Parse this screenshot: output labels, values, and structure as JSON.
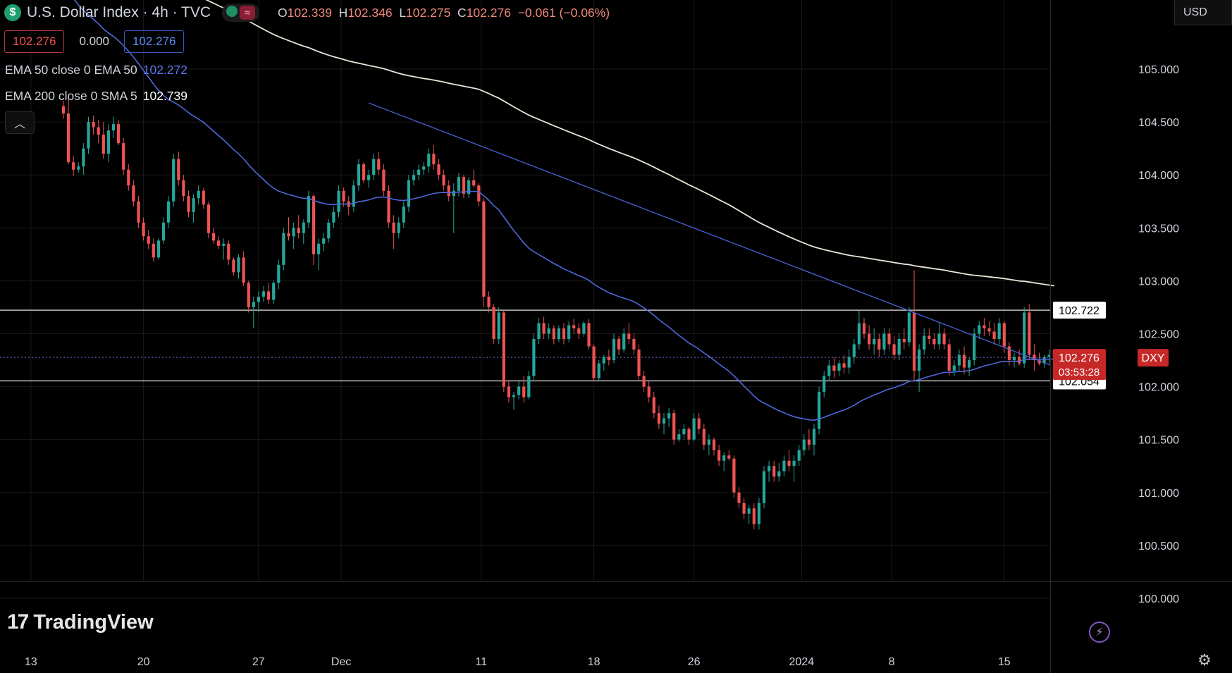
{
  "header": {
    "symbol_icon": "dollar-icon",
    "symbol_glyph": "$",
    "title": "U.S. Dollar Index · 4h · TVC",
    "open_label": "O",
    "open": "102.339",
    "high_label": "H",
    "high": "102.346",
    "low_label": "L",
    "low": "102.275",
    "close_label": "C",
    "close": "102.276",
    "change": "−0.061 (−0.06%)"
  },
  "price_boxes": {
    "bid": "102.276",
    "spread": "0.000",
    "ask": "102.276"
  },
  "indicators": [
    {
      "label": "EMA 50 close 0 EMA 50",
      "value": "102.272",
      "color": "#4f68d9"
    },
    {
      "label": "EMA 200 close 0 SMA 5",
      "value": "102.739",
      "color": "#e8e6d8"
    }
  ],
  "collapse_glyph": "^",
  "currency": "USD",
  "logo": {
    "mark": "17",
    "text": "TradingView"
  },
  "icons": [
    "dollar-icon",
    "chevron-up-icon",
    "lightning-icon",
    "settings-icon"
  ],
  "colors": {
    "up": "#26a69a",
    "down": "#ef5350",
    "ema50": "#4f68d9",
    "ema200": "#e8e6d8",
    "trend": "#4a64d6",
    "label_red": "#c62828"
  },
  "chart_data": {
    "type": "candlestick",
    "symbol": "DXY",
    "y_axis": {
      "ticks": [
        "105.000",
        "104.500",
        "104.000",
        "103.500",
        "103.000",
        "102.500",
        "102.000",
        "101.500",
        "101.000",
        "100.500",
        "100.000"
      ],
      "range": [
        99.7,
        105.5
      ]
    },
    "x_axis": {
      "ticks": [
        "13",
        "20",
        "27",
        "Dec",
        "11",
        "18",
        "26",
        "2024",
        "8",
        "15"
      ]
    },
    "horizontal_lines": [
      {
        "price": 102.722,
        "label": "102.722"
      },
      {
        "price": 102.054,
        "label": "102.054"
      }
    ],
    "last_price": {
      "symbol": "DXY",
      "price": 102.276,
      "label": "102.276",
      "countdown": "03:53:28"
    },
    "trendline": [
      {
        "bar": 61,
        "price": 104.68
      },
      {
        "bar": 182,
        "price": 102.48
      }
    ],
    "ohlc": [
      [
        104.65,
        104.7,
        104.53,
        104.58
      ],
      [
        104.58,
        104.72,
        104.1,
        104.12
      ],
      [
        104.12,
        104.18,
        103.99,
        104.05
      ],
      [
        104.05,
        104.12,
        104.02,
        104.08
      ],
      [
        104.08,
        104.3,
        104.0,
        104.25
      ],
      [
        104.25,
        104.55,
        104.2,
        104.5
      ],
      [
        104.5,
        104.56,
        104.38,
        104.45
      ],
      [
        104.45,
        104.52,
        104.3,
        104.38
      ],
      [
        104.38,
        104.5,
        104.15,
        104.2
      ],
      [
        104.2,
        104.48,
        104.12,
        104.42
      ],
      [
        104.42,
        104.55,
        104.35,
        104.48
      ],
      [
        104.48,
        104.52,
        104.28,
        104.3
      ],
      [
        104.3,
        104.35,
        104.0,
        104.05
      ],
      [
        104.05,
        104.1,
        103.85,
        103.9
      ],
      [
        103.9,
        103.95,
        103.7,
        103.75
      ],
      [
        103.75,
        103.8,
        103.5,
        103.55
      ],
      [
        103.55,
        103.6,
        103.38,
        103.42
      ],
      [
        103.42,
        103.48,
        103.3,
        103.35
      ],
      [
        103.35,
        103.4,
        103.18,
        103.22
      ],
      [
        103.22,
        103.4,
        103.2,
        103.38
      ],
      [
        103.38,
        103.6,
        103.35,
        103.55
      ],
      [
        103.55,
        103.8,
        103.5,
        103.75
      ],
      [
        103.75,
        104.2,
        103.7,
        104.15
      ],
      [
        104.15,
        104.22,
        103.9,
        103.95
      ],
      [
        103.95,
        104.0,
        103.75,
        103.8
      ],
      [
        103.8,
        103.85,
        103.6,
        103.65
      ],
      [
        103.65,
        103.82,
        103.55,
        103.78
      ],
      [
        103.78,
        103.9,
        103.72,
        103.85
      ],
      [
        103.85,
        103.88,
        103.68,
        103.72
      ],
      [
        103.72,
        103.75,
        103.4,
        103.45
      ],
      [
        103.45,
        103.5,
        103.35,
        103.38
      ],
      [
        103.38,
        103.42,
        103.3,
        103.33
      ],
      [
        103.33,
        103.4,
        103.2,
        103.35
      ],
      [
        103.35,
        103.38,
        103.15,
        103.2
      ],
      [
        103.2,
        103.22,
        103.05,
        103.08
      ],
      [
        103.08,
        103.25,
        103.02,
        103.22
      ],
      [
        103.22,
        103.28,
        102.95,
        102.98
      ],
      [
        102.98,
        103.0,
        102.7,
        102.75
      ],
      [
        102.75,
        102.85,
        102.55,
        102.8
      ],
      [
        102.8,
        102.9,
        102.7,
        102.85
      ],
      [
        102.85,
        102.95,
        102.8,
        102.9
      ],
      [
        102.9,
        102.98,
        102.78,
        102.82
      ],
      [
        102.82,
        103.0,
        102.78,
        102.98
      ],
      [
        102.98,
        103.2,
        102.92,
        103.15
      ],
      [
        103.15,
        103.5,
        103.1,
        103.45
      ],
      [
        103.45,
        103.6,
        103.38,
        103.42
      ],
      [
        103.42,
        103.55,
        103.3,
        103.5
      ],
      [
        103.5,
        103.62,
        103.4,
        103.45
      ],
      [
        103.45,
        103.58,
        103.35,
        103.55
      ],
      [
        103.55,
        103.85,
        103.5,
        103.8
      ],
      [
        103.8,
        103.82,
        103.15,
        103.25
      ],
      [
        103.25,
        103.4,
        103.1,
        103.35
      ],
      [
        103.35,
        103.45,
        103.28,
        103.4
      ],
      [
        103.4,
        103.58,
        103.36,
        103.55
      ],
      [
        103.55,
        103.7,
        103.5,
        103.65
      ],
      [
        103.65,
        103.9,
        103.6,
        103.85
      ],
      [
        103.85,
        103.88,
        103.7,
        103.75
      ],
      [
        103.75,
        103.8,
        103.62,
        103.7
      ],
      [
        103.7,
        103.95,
        103.65,
        103.9
      ],
      [
        103.9,
        104.15,
        103.85,
        104.1
      ],
      [
        104.1,
        104.12,
        103.92,
        103.95
      ],
      [
        103.95,
        104.05,
        103.88,
        104.0
      ],
      [
        104.0,
        104.2,
        103.95,
        104.15
      ],
      [
        104.15,
        104.22,
        104.0,
        104.05
      ],
      [
        104.05,
        104.1,
        103.8,
        103.85
      ],
      [
        103.85,
        103.9,
        103.5,
        103.55
      ],
      [
        103.55,
        103.62,
        103.3,
        103.45
      ],
      [
        103.45,
        103.6,
        103.4,
        103.55
      ],
      [
        103.55,
        103.75,
        103.5,
        103.7
      ],
      [
        103.7,
        104.0,
        103.65,
        103.95
      ],
      [
        103.95,
        104.05,
        103.9,
        104.0
      ],
      [
        104.0,
        104.1,
        103.95,
        104.05
      ],
      [
        104.05,
        104.12,
        104.0,
        104.08
      ],
      [
        104.08,
        104.25,
        104.02,
        104.2
      ],
      [
        104.2,
        104.28,
        104.05,
        104.1
      ],
      [
        104.1,
        104.15,
        103.95,
        104.0
      ],
      [
        104.0,
        104.05,
        103.85,
        103.9
      ],
      [
        103.9,
        103.95,
        103.75,
        103.8
      ],
      [
        103.8,
        103.92,
        103.45,
        103.85
      ],
      [
        103.85,
        104.02,
        103.8,
        103.98
      ],
      [
        103.98,
        104.0,
        103.78,
        103.82
      ],
      [
        103.82,
        103.98,
        103.78,
        103.95
      ],
      [
        103.95,
        104.05,
        103.88,
        103.9
      ],
      [
        103.9,
        103.92,
        103.7,
        103.75
      ],
      [
        103.75,
        103.78,
        102.75,
        102.85
      ],
      [
        102.85,
        102.9,
        102.7,
        102.75
      ],
      [
        102.75,
        102.78,
        102.4,
        102.45
      ],
      [
        102.45,
        102.75,
        102.4,
        102.7
      ],
      [
        102.7,
        102.72,
        101.95,
        102.0
      ],
      [
        102.0,
        102.05,
        101.85,
        101.9
      ],
      [
        101.9,
        101.95,
        101.78,
        101.92
      ],
      [
        101.92,
        102.05,
        101.88,
        102.0
      ],
      [
        102.0,
        102.1,
        101.85,
        101.9
      ],
      [
        101.9,
        102.15,
        101.88,
        102.1
      ],
      [
        102.1,
        102.5,
        102.05,
        102.45
      ],
      [
        102.45,
        102.65,
        102.4,
        102.6
      ],
      [
        102.6,
        102.66,
        102.45,
        102.5
      ],
      [
        102.5,
        102.6,
        102.45,
        102.55
      ],
      [
        102.55,
        102.58,
        102.4,
        102.45
      ],
      [
        102.45,
        102.58,
        102.42,
        102.55
      ],
      [
        102.55,
        102.6,
        102.4,
        102.45
      ],
      [
        102.45,
        102.62,
        102.42,
        102.58
      ],
      [
        102.58,
        102.64,
        102.5,
        102.55
      ],
      [
        102.55,
        102.6,
        102.45,
        102.5
      ],
      [
        102.5,
        102.62,
        102.47,
        102.6
      ],
      [
        102.6,
        102.64,
        102.35,
        102.38
      ],
      [
        102.38,
        102.4,
        102.05,
        102.08
      ],
      [
        102.08,
        102.25,
        102.05,
        102.22
      ],
      [
        102.22,
        102.3,
        102.15,
        102.28
      ],
      [
        102.28,
        102.35,
        102.2,
        102.25
      ],
      [
        102.25,
        102.5,
        102.22,
        102.45
      ],
      [
        102.45,
        102.48,
        102.3,
        102.35
      ],
      [
        102.35,
        102.55,
        102.32,
        102.5
      ],
      [
        102.5,
        102.6,
        102.4,
        102.45
      ],
      [
        102.45,
        102.5,
        102.3,
        102.35
      ],
      [
        102.35,
        102.4,
        102.05,
        102.1
      ],
      [
        102.1,
        102.15,
        101.95,
        102.0
      ],
      [
        102.0,
        102.05,
        101.85,
        101.9
      ],
      [
        101.9,
        101.95,
        101.7,
        101.75
      ],
      [
        101.75,
        101.82,
        101.6,
        101.65
      ],
      [
        101.65,
        101.75,
        101.55,
        101.7
      ],
      [
        101.7,
        101.8,
        101.62,
        101.75
      ],
      [
        101.75,
        101.78,
        101.45,
        101.5
      ],
      [
        101.5,
        101.6,
        101.48,
        101.55
      ],
      [
        101.55,
        101.65,
        101.5,
        101.6
      ],
      [
        101.6,
        101.62,
        101.45,
        101.5
      ],
      [
        101.5,
        101.75,
        101.48,
        101.7
      ],
      [
        101.7,
        101.75,
        101.55,
        101.6
      ],
      [
        101.6,
        101.65,
        101.4,
        101.45
      ],
      [
        101.45,
        101.55,
        101.35,
        101.5
      ],
      [
        101.5,
        101.52,
        101.35,
        101.4
      ],
      [
        101.4,
        101.45,
        101.25,
        101.3
      ],
      [
        101.3,
        101.38,
        101.2,
        101.35
      ],
      [
        101.35,
        101.4,
        101.3,
        101.32
      ],
      [
        101.32,
        101.35,
        100.95,
        101.0
      ],
      [
        101.0,
        101.05,
        100.85,
        100.9
      ],
      [
        100.9,
        100.95,
        100.75,
        100.8
      ],
      [
        100.8,
        100.88,
        100.7,
        100.85
      ],
      [
        100.85,
        100.9,
        100.65,
        100.7
      ],
      [
        100.7,
        100.95,
        100.65,
        100.9
      ],
      [
        100.9,
        101.25,
        100.85,
        101.2
      ],
      [
        101.2,
        101.3,
        101.1,
        101.25
      ],
      [
        101.25,
        101.3,
        101.1,
        101.15
      ],
      [
        101.15,
        101.28,
        101.1,
        101.2
      ],
      [
        101.2,
        101.35,
        101.15,
        101.3
      ],
      [
        101.3,
        101.4,
        101.2,
        101.25
      ],
      [
        101.25,
        101.35,
        101.1,
        101.3
      ],
      [
        101.3,
        101.45,
        101.25,
        101.4
      ],
      [
        101.4,
        101.55,
        101.35,
        101.5
      ],
      [
        101.5,
        101.6,
        101.4,
        101.45
      ],
      [
        101.45,
        101.65,
        101.35,
        101.6
      ],
      [
        101.6,
        102.0,
        101.55,
        101.95
      ],
      [
        101.95,
        102.15,
        101.9,
        102.1
      ],
      [
        102.1,
        102.25,
        102.05,
        102.2
      ],
      [
        102.2,
        102.28,
        102.08,
        102.15
      ],
      [
        102.15,
        102.25,
        102.1,
        102.22
      ],
      [
        102.22,
        102.3,
        102.12,
        102.18
      ],
      [
        102.18,
        102.35,
        102.12,
        102.28
      ],
      [
        102.28,
        102.45,
        102.22,
        102.4
      ],
      [
        102.4,
        102.72,
        102.35,
        102.6
      ],
      [
        102.6,
        102.65,
        102.45,
        102.5
      ],
      [
        102.5,
        102.58,
        102.35,
        102.4
      ],
      [
        102.4,
        102.55,
        102.3,
        102.45
      ],
      [
        102.45,
        102.5,
        102.28,
        102.35
      ],
      [
        102.35,
        102.55,
        102.3,
        102.5
      ],
      [
        102.5,
        102.55,
        102.35,
        102.4
      ],
      [
        102.4,
        102.48,
        102.25,
        102.3
      ],
      [
        102.3,
        102.5,
        102.25,
        102.45
      ],
      [
        102.45,
        102.55,
        102.35,
        102.42
      ],
      [
        102.42,
        102.75,
        102.38,
        102.7
      ],
      [
        102.7,
        103.1,
        102.05,
        102.15
      ],
      [
        102.15,
        102.4,
        101.95,
        102.35
      ],
      [
        102.35,
        102.55,
        102.3,
        102.48
      ],
      [
        102.48,
        102.55,
        102.4,
        102.45
      ],
      [
        102.45,
        102.5,
        102.35,
        102.4
      ],
      [
        102.4,
        102.6,
        102.35,
        102.5
      ],
      [
        102.5,
        102.55,
        102.35,
        102.4
      ],
      [
        102.4,
        102.45,
        102.1,
        102.15
      ],
      [
        102.15,
        102.25,
        102.1,
        102.2
      ],
      [
        102.2,
        102.35,
        102.15,
        102.3
      ],
      [
        102.3,
        102.38,
        102.12,
        102.18
      ],
      [
        102.18,
        102.28,
        102.1,
        102.25
      ],
      [
        102.25,
        102.55,
        102.2,
        102.5
      ],
      [
        102.5,
        102.62,
        102.45,
        102.58
      ],
      [
        102.58,
        102.65,
        102.48,
        102.55
      ],
      [
        102.55,
        102.62,
        102.48,
        102.52
      ],
      [
        102.52,
        102.6,
        102.4,
        102.45
      ],
      [
        102.45,
        102.65,
        102.4,
        102.6
      ],
      [
        102.6,
        102.62,
        102.32,
        102.38
      ],
      [
        102.38,
        102.42,
        102.2,
        102.25
      ],
      [
        102.25,
        102.32,
        102.18,
        102.28
      ],
      [
        102.28,
        102.35,
        102.2,
        102.22
      ],
      [
        102.22,
        102.75,
        102.18,
        102.7
      ],
      [
        102.7,
        102.78,
        102.25,
        102.3
      ],
      [
        102.3,
        102.4,
        102.15,
        102.25
      ],
      [
        102.25,
        102.32,
        102.2,
        102.22
      ],
      [
        102.22,
        102.3,
        102.18,
        102.28
      ],
      [
        102.28,
        102.35,
        102.22,
        102.3
      ],
      [
        102.339,
        102.346,
        102.275,
        102.276
      ]
    ]
  }
}
